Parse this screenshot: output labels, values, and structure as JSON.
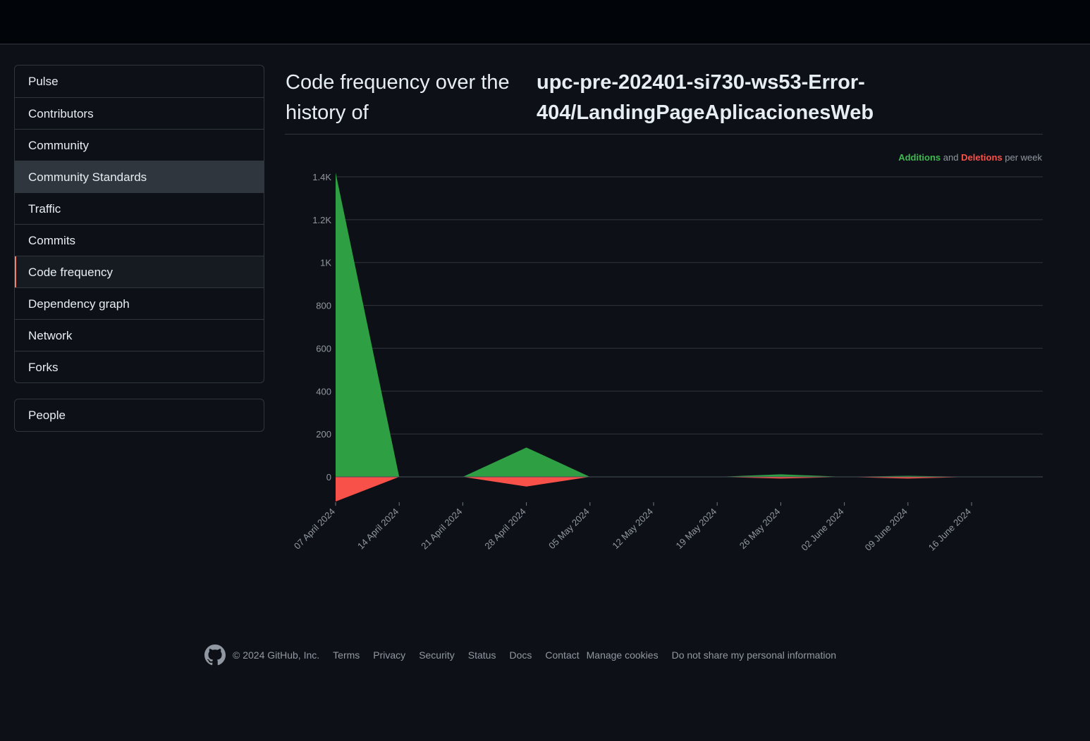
{
  "header": {},
  "sidebar": {
    "items": [
      {
        "label": "Pulse"
      },
      {
        "label": "Contributors"
      },
      {
        "label": "Community"
      },
      {
        "label": "Community Standards"
      },
      {
        "label": "Traffic"
      },
      {
        "label": "Commits"
      },
      {
        "label": "Code frequency"
      },
      {
        "label": "Dependency graph"
      },
      {
        "label": "Network"
      },
      {
        "label": "Forks"
      }
    ],
    "hovered_item": "Community Standards",
    "selected_item": "Code frequency",
    "people_label": "People"
  },
  "main": {
    "title_prefix": "Code frequency over the history of",
    "repo_name": "upc-pre-202401-si730-ws53-Error-404/LandingPageAplicacionesWeb"
  },
  "legend": {
    "additions": "Additions",
    "and": "and",
    "deletions": "Deletions",
    "suffix": "per week"
  },
  "chart_data": {
    "type": "area",
    "x": [
      "07 April 2024",
      "14 April 2024",
      "21 April 2024",
      "28 April 2024",
      "05 May 2024",
      "12 May 2024",
      "19 May 2024",
      "26 May 2024",
      "02 June 2024",
      "09 June 2024",
      "16 June 2024"
    ],
    "series": [
      {
        "name": "Additions",
        "color": "#2ea043",
        "values": [
          1420,
          0,
          0,
          137,
          0,
          0,
          0,
          12,
          0,
          5,
          0
        ]
      },
      {
        "name": "Deletions",
        "color": "#f85149",
        "values": [
          -115,
          0,
          0,
          -45,
          0,
          0,
          0,
          -8,
          0,
          -8,
          0
        ]
      }
    ],
    "yticks": [
      "0",
      "200",
      "400",
      "600",
      "800",
      "1K",
      "1.2K",
      "1.4K"
    ],
    "ytick_values": [
      0,
      200,
      400,
      600,
      800,
      1000,
      1200,
      1400
    ],
    "ylim": [
      -115,
      1400
    ],
    "grid": true,
    "legend_position": "top-right"
  },
  "footer": {
    "copyright": "© 2024 GitHub, Inc.",
    "links": [
      "Terms",
      "Privacy",
      "Security",
      "Status",
      "Docs",
      "Contact",
      "Manage cookies",
      "Do not share my personal information"
    ]
  },
  "colors": {
    "background": "#0d1117",
    "topbar": "#010409",
    "border": "#30363d",
    "selected_indicator": "#f78166",
    "additions": "#2ea043",
    "deletions": "#f85149"
  }
}
